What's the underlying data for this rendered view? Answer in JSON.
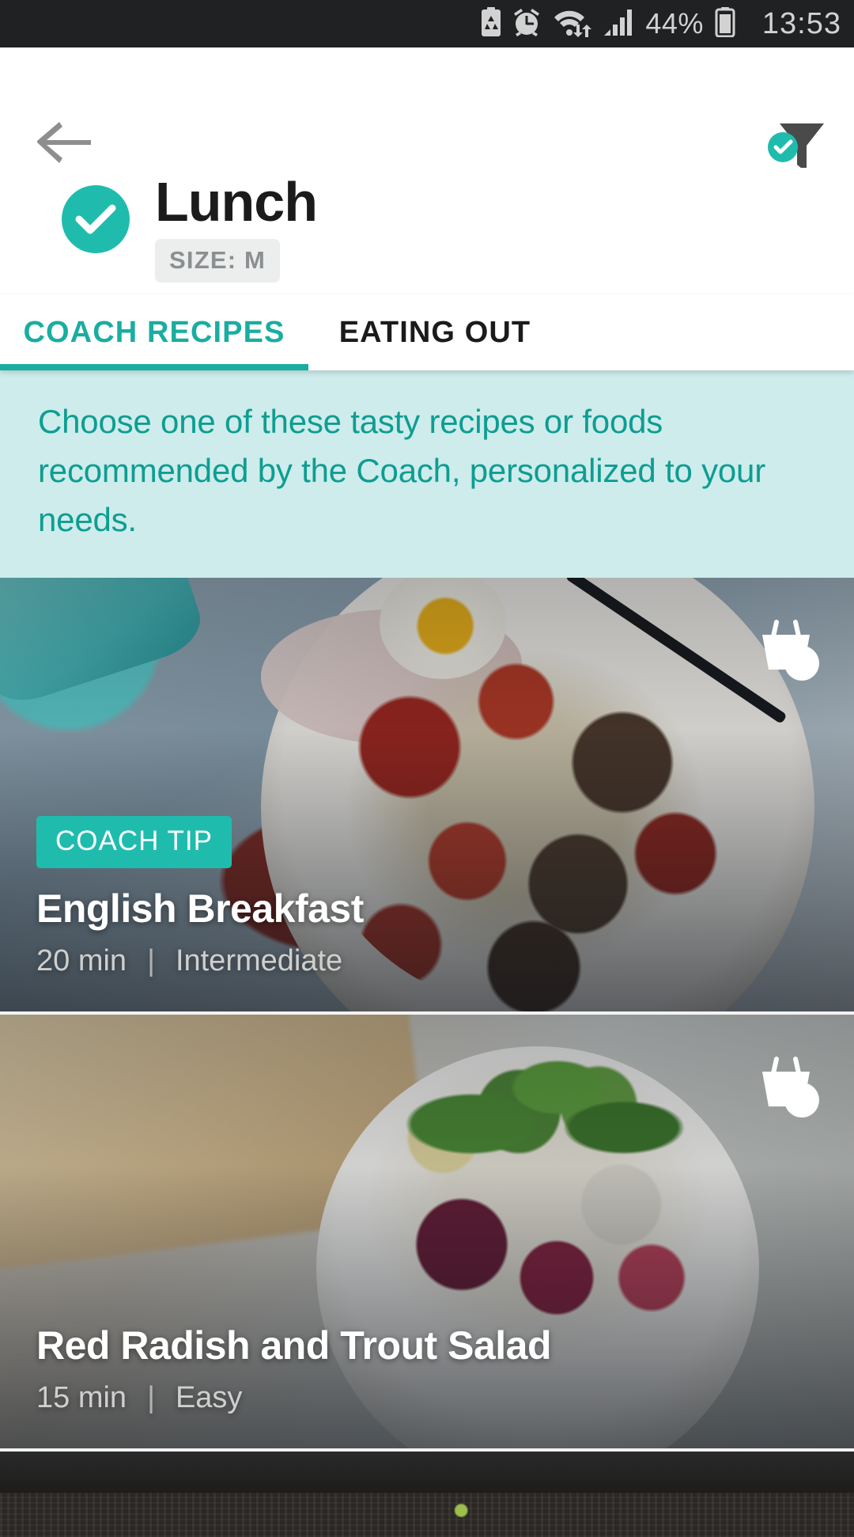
{
  "statusbar": {
    "battery_percent": "44%",
    "time": "13:53",
    "icons": [
      "battery-saver-icon",
      "alarm-icon",
      "wifi-icon",
      "signal-icon",
      "battery-icon"
    ]
  },
  "appbar": {
    "back_icon": "back-arrow-icon",
    "filter_icon": "filter-funnel-icon",
    "filter_badge_icon": "check-badge-icon"
  },
  "header": {
    "check_icon": "check-circle-icon",
    "title": "Lunch",
    "size_badge": "SIZE: M"
  },
  "tabs": [
    {
      "label": "COACH RECIPES",
      "active": true
    },
    {
      "label": "EATING OUT",
      "active": false
    }
  ],
  "banner": {
    "text": "Choose one of these tasty recipes or foods recommended by the Coach, personalized to your needs."
  },
  "recipes": [
    {
      "badge": "COACH TIP",
      "title": "English Breakfast",
      "time": "20 min",
      "separator": "|",
      "difficulty": "Intermediate",
      "basket_icon": "add-to-basket-icon"
    },
    {
      "badge": "",
      "title": "Red Radish and Trout Salad",
      "time": "15 min",
      "separator": "|",
      "difficulty": "Easy",
      "basket_icon": "add-to-basket-icon"
    }
  ],
  "colors": {
    "accent_teal": "#1fbcae",
    "tab_teal": "#1aada1",
    "banner_bg": "#cdeceb",
    "banner_text": "#0e9d92",
    "statusbar_bg": "#1f2123"
  }
}
